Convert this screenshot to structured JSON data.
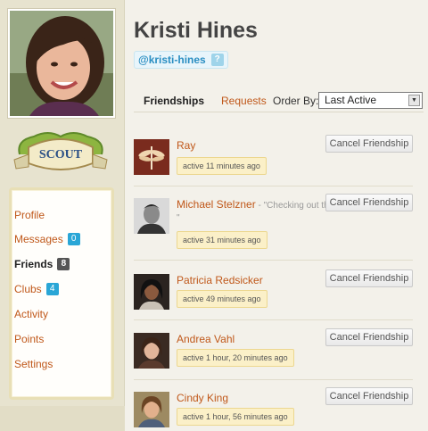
{
  "profile": {
    "name": "Kristi Hines",
    "handle": "@kristi-hines",
    "help_glyph": "?",
    "badge_text": "SCOUT"
  },
  "nav": {
    "items": [
      {
        "label": "Profile",
        "count": null,
        "active": false
      },
      {
        "label": "Messages",
        "count": "0",
        "active": false
      },
      {
        "label": "Friends",
        "count": "8",
        "active": true
      },
      {
        "label": "Clubs",
        "count": "4",
        "active": false
      },
      {
        "label": "Activity",
        "count": null,
        "active": false
      },
      {
        "label": "Points",
        "count": null,
        "active": false
      },
      {
        "label": "Settings",
        "count": null,
        "active": false
      }
    ]
  },
  "tabs": {
    "friendships": "Friendships",
    "requests": "Requests",
    "order_by_label": "Order By:",
    "order_by_value": "Last Active",
    "arrow_glyph": "▼"
  },
  "friends": [
    {
      "name": "Ray",
      "status": "",
      "active": "active 11 minutes ago",
      "button": "Cancel Friendship",
      "thumb": "dragonfly-thumbnail"
    },
    {
      "name": "Michael Stelzner",
      "status": " - \"Checking out the",
      "status2": "\"",
      "active": "active 31 minutes ago",
      "button": "Cancel Friendship",
      "thumb": "man-portrait-thumbnail"
    },
    {
      "name": "Patricia Redsicker",
      "status": "",
      "active": "active 49 minutes ago",
      "button": "Cancel Friendship",
      "thumb": "woman-portrait-thumbnail"
    },
    {
      "name": "Andrea Vahl",
      "status": "",
      "active": "active 1 hour, 20 minutes ago",
      "button": "Cancel Friendship",
      "thumb": "woman-portrait-thumbnail"
    },
    {
      "name": "Cindy King",
      "status": "",
      "active": "active 1 hour, 56 minutes ago",
      "button": "Cancel Friendship",
      "thumb": "woman-portrait-thumbnail"
    }
  ],
  "colors": {
    "link": "#c0581a",
    "count_badge": "#2aa6d6",
    "active_badge_bg": "#fbf0c8",
    "handle_text": "#2a8ec2"
  }
}
